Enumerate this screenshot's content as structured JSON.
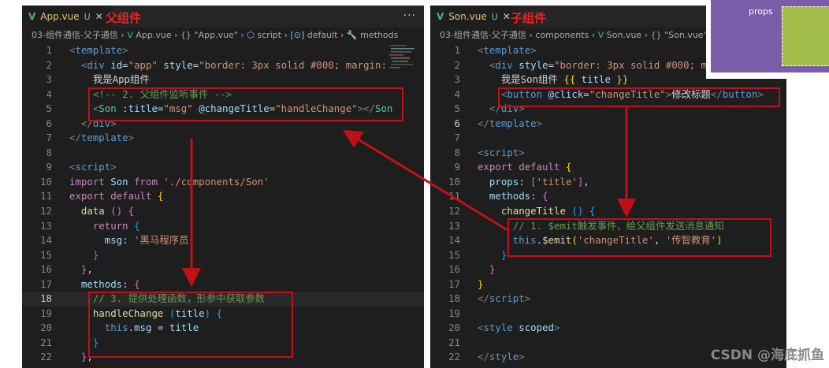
{
  "left_tab": {
    "filename": "App.vue",
    "modified": "U",
    "close": "✕",
    "annotation": "父组件",
    "more": "···"
  },
  "right_tab": {
    "filename": "Son.vue",
    "modified": "U",
    "close": "✕",
    "annotation": "子组件"
  },
  "left_crumb": [
    "03-组件通信-父子通信",
    "App.vue",
    "{} \"App.vue\"",
    "script",
    "default",
    "methods"
  ],
  "right_crumb": [
    "03-组件通信-父子通信",
    "components",
    "Son.vue",
    "{} \"Son.vue\""
  ],
  "left_line_numbers": [
    "1",
    "2",
    "3",
    "4",
    "5",
    "6",
    "7",
    "8",
    "9",
    "10",
    "11",
    "12",
    "13",
    "14",
    "15",
    "16",
    "17",
    "18",
    "19",
    "20",
    "21",
    "22"
  ],
  "right_line_numbers": [
    "1",
    "2",
    "3",
    "4",
    "5",
    "6",
    "7",
    "8",
    "9",
    "10",
    "11",
    "12",
    "13",
    "14",
    "15",
    "16",
    "17",
    "18",
    "19",
    "20",
    "21",
    "22"
  ],
  "thumbnail": {
    "label": "props"
  },
  "watermark": "CSDN @海底抓鱼",
  "colors": {
    "annotation_red": "#e22222",
    "box_red": "#c0101a",
    "editor_bg": "#1e1e1e"
  }
}
